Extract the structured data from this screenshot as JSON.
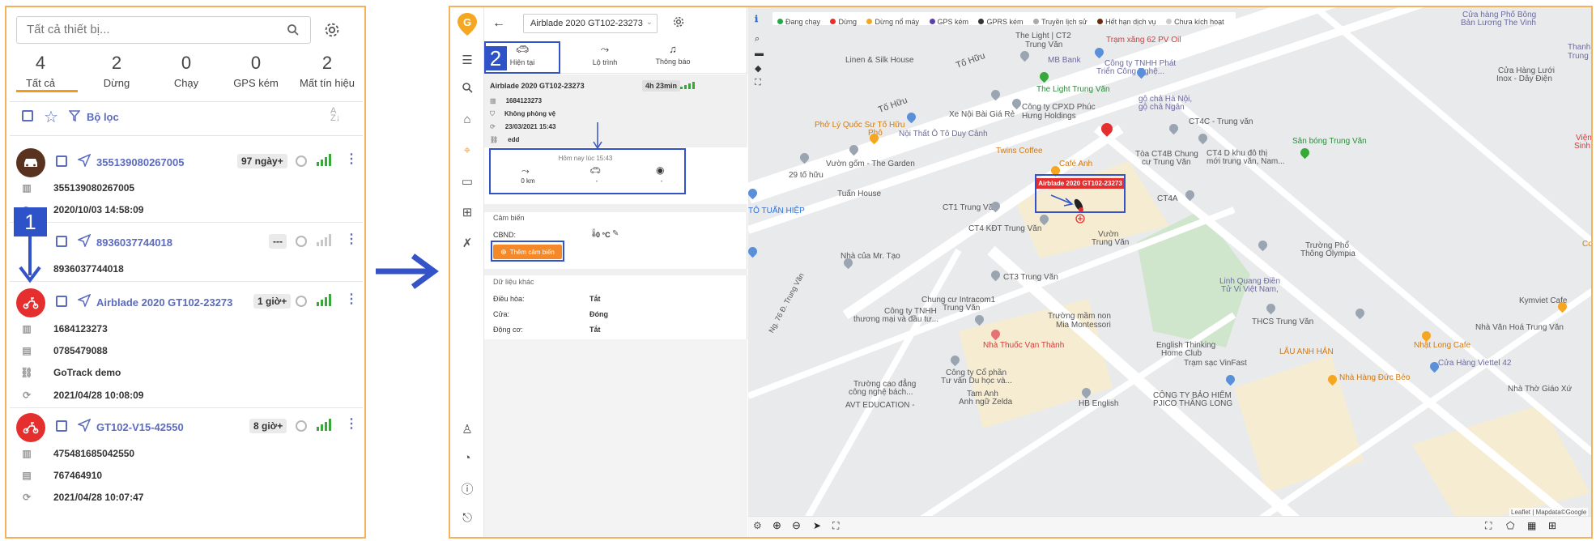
{
  "left": {
    "search_placeholder": "Tất cả thiết bị...",
    "stats": [
      {
        "count": "4",
        "label": "Tất cả"
      },
      {
        "count": "2",
        "label": "Dừng"
      },
      {
        "count": "0",
        "label": "Chạy"
      },
      {
        "count": "0",
        "label": "GPS kém"
      },
      {
        "count": "2",
        "label": "Mất tín hiệu"
      }
    ],
    "filter_label": "Bộ lọc",
    "vehicles": [
      {
        "name": "355139080267005",
        "badge": "97 ngày+",
        "avatar_color": "#5a3320",
        "lines": [
          "355139080267005",
          "2020/10/03 14:58:09"
        ]
      },
      {
        "name": "8936037744018",
        "badge": "---",
        "avatar_color": "#cccccc",
        "lines": [
          "8936037744018"
        ]
      },
      {
        "name": "Airblade 2020 GT102-23273",
        "badge": "1 giờ+",
        "avatar_color": "#e52f2f",
        "lines": [
          "1684123273",
          "0785479088",
          "GoTrack demo",
          "2021/04/28 10:08:09"
        ]
      },
      {
        "name": "GT102-V15-42550",
        "badge": "8 giờ+",
        "avatar_color": "#e52f2f",
        "lines": [
          "475481685042550",
          "767464910",
          "2021/04/28 10:07:47"
        ]
      }
    ]
  },
  "annotations": {
    "one": "1",
    "two": "2"
  },
  "detail": {
    "vehicle_select": "Airblade 2020 GT102-23273",
    "tabs": [
      "Hiện tại",
      "Lộ trình",
      "Thông báo"
    ],
    "header_title": "Airblade 2020 GT102-23273",
    "header_time": "4h 23min",
    "info": [
      "1684123273",
      "Không phòng vệ",
      "23/03/2021 15:43",
      "edd"
    ],
    "today_label": "Hôm nay lúc 15:43",
    "today_stats": [
      "0 km",
      "-",
      "-"
    ],
    "sensor_title": "Cảm biến",
    "sensor_name": "CBND:",
    "sensor_value": "0 °C",
    "add_sensor": "Thêm cảm biến",
    "other_title": "Dữ liệu khác",
    "other": [
      {
        "label": "Điều hòa:",
        "value": "Tắt"
      },
      {
        "label": "Cửa:",
        "value": "Đóng"
      },
      {
        "label": "Động cơ:",
        "value": "Tắt"
      }
    ]
  },
  "map": {
    "legend": [
      {
        "label": "Đang chạy",
        "color": "#22aa44"
      },
      {
        "label": "Dừng",
        "color": "#e52f2f"
      },
      {
        "label": "Dừng nổ máy",
        "color": "#f5a623"
      },
      {
        "label": "GPS kém",
        "color": "#5b3db0"
      },
      {
        "label": "GPRS kém",
        "color": "#333333"
      },
      {
        "label": "Truyền lịch sử",
        "color": "#aaaaaa"
      },
      {
        "label": "Hết hạn dịch vụ",
        "color": "#6b2b0c"
      },
      {
        "label": "Chưa kích hoạt",
        "color": "#cccccc"
      }
    ],
    "vehicle_label": "Airblade 2020 GT102-23273",
    "attribution": "Leaflet | Mapdata©Google",
    "labels": [
      "Cửa hàng Phố Bông",
      "Bản Lương The Vinh",
      "The Light | CT2",
      "Trung Văn",
      "Trạm xăng 62 PV Oil",
      "Thanh Lý Sắt",
      "Trung Văn",
      "Linen & Silk House",
      "MB Bank",
      "Công ty TNHH Phát",
      "Triển Công Nghệ...",
      "Tố Hữu",
      "Cửa Hàng Lưới",
      "Inox - Dây Điện",
      "The Light Trung Văn",
      "Tố Hữu",
      "Xe Nội Bài Giá Rẻ",
      "Công ty CPXD Phúc",
      "Hưng Holdings",
      "gộ chả Hà Nội,",
      "gộ chả Ngân",
      "Phở Lý Quốc Sư Tố Hữu",
      "Phô",
      "Nội Thất Ô Tô Duy Cảnh",
      "CT4C - Trung văn",
      "Viện Sốt",
      "Sinh Trung",
      "Sân bóng Trung Văn",
      "Twins Coffee",
      "Vườn gốm - The Garden",
      "29 tố hữu",
      "Café Anh",
      "Tòa CT4B Chung",
      "cư Trung Văn",
      "CT4 D khu đô thị",
      "mới trung văn, Nam...",
      "Tuấn House",
      "CT4A",
      "TÔ TUẤN HIỆP",
      "CT1 Trung Văn",
      "CT4 KĐT Trung Văn",
      "Vườn",
      "Trung Văn",
      "Nhà của Mr. Tạo",
      "Trường Phổ",
      "Thông Olympia",
      "CT3 Trung Văn",
      "Chung cư Intracom1",
      "Trung Văn",
      "Linh Quang Điền",
      "Tử Vi Việt Nam,",
      "Kymviet Cafe",
      "Công ty TNHH",
      "thương mại và đầu tư...",
      "Trường mầm non",
      "Mia Montessori",
      "THCS Trung Văn",
      "Nhà Văn Hoá Trung Văn",
      "Nhà Thuốc Vạn Thành",
      "English Thinking",
      "Home Club",
      "Nhật Long Cafe",
      "LẨU ANH HẢN",
      "Trạm sạc VinFast",
      "Cửa Hàng Viettel 42",
      "Nhà Hàng Đức Béo",
      "Công ty Cổ phần",
      "Tư vấn Du học và...",
      "Trường cao đẳng",
      "công nghệ bách...",
      "Tam Anh",
      "Anh ngữ Zelda",
      "Nhà Thờ Giáo Xứ",
      "AVT EDUCATION -",
      "HB English",
      "CÔNG TY BẢO HIỂM",
      "PJICO THĂNG LONG",
      "Ng. 76 Đ. Trung Văn",
      "Cof"
    ]
  }
}
